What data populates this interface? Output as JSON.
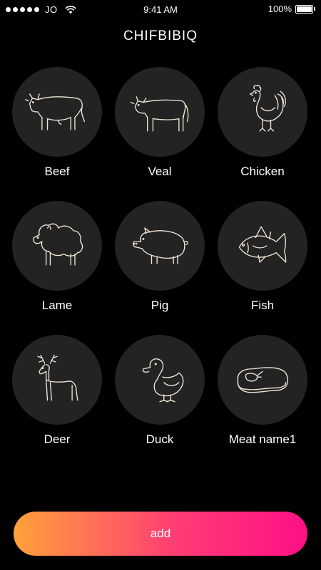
{
  "status_bar": {
    "carrier": "JO",
    "time": "9:41 AM",
    "battery": "100%",
    "signal_bars": 5
  },
  "header": {
    "title": "CHIFBIBIQ"
  },
  "meats": [
    {
      "label": "Beef",
      "icon": "cow-icon"
    },
    {
      "label": "Veal",
      "icon": "calf-icon"
    },
    {
      "label": "Chicken",
      "icon": "chicken-icon"
    },
    {
      "label": "Lame",
      "icon": "sheep-icon"
    },
    {
      "label": "Pig",
      "icon": "pig-icon"
    },
    {
      "label": "Fish",
      "icon": "fish-icon"
    },
    {
      "label": "Deer",
      "icon": "deer-icon"
    },
    {
      "label": "Duck",
      "icon": "duck-icon"
    },
    {
      "label": "Meat name1",
      "icon": "steak-icon"
    }
  ],
  "actions": {
    "add_label": "add"
  },
  "colors": {
    "background": "#000000",
    "tile": "#232323",
    "line_art": "#f2e6d6",
    "gradient_start": "#ffa23a",
    "gradient_end": "#ff0f86"
  }
}
